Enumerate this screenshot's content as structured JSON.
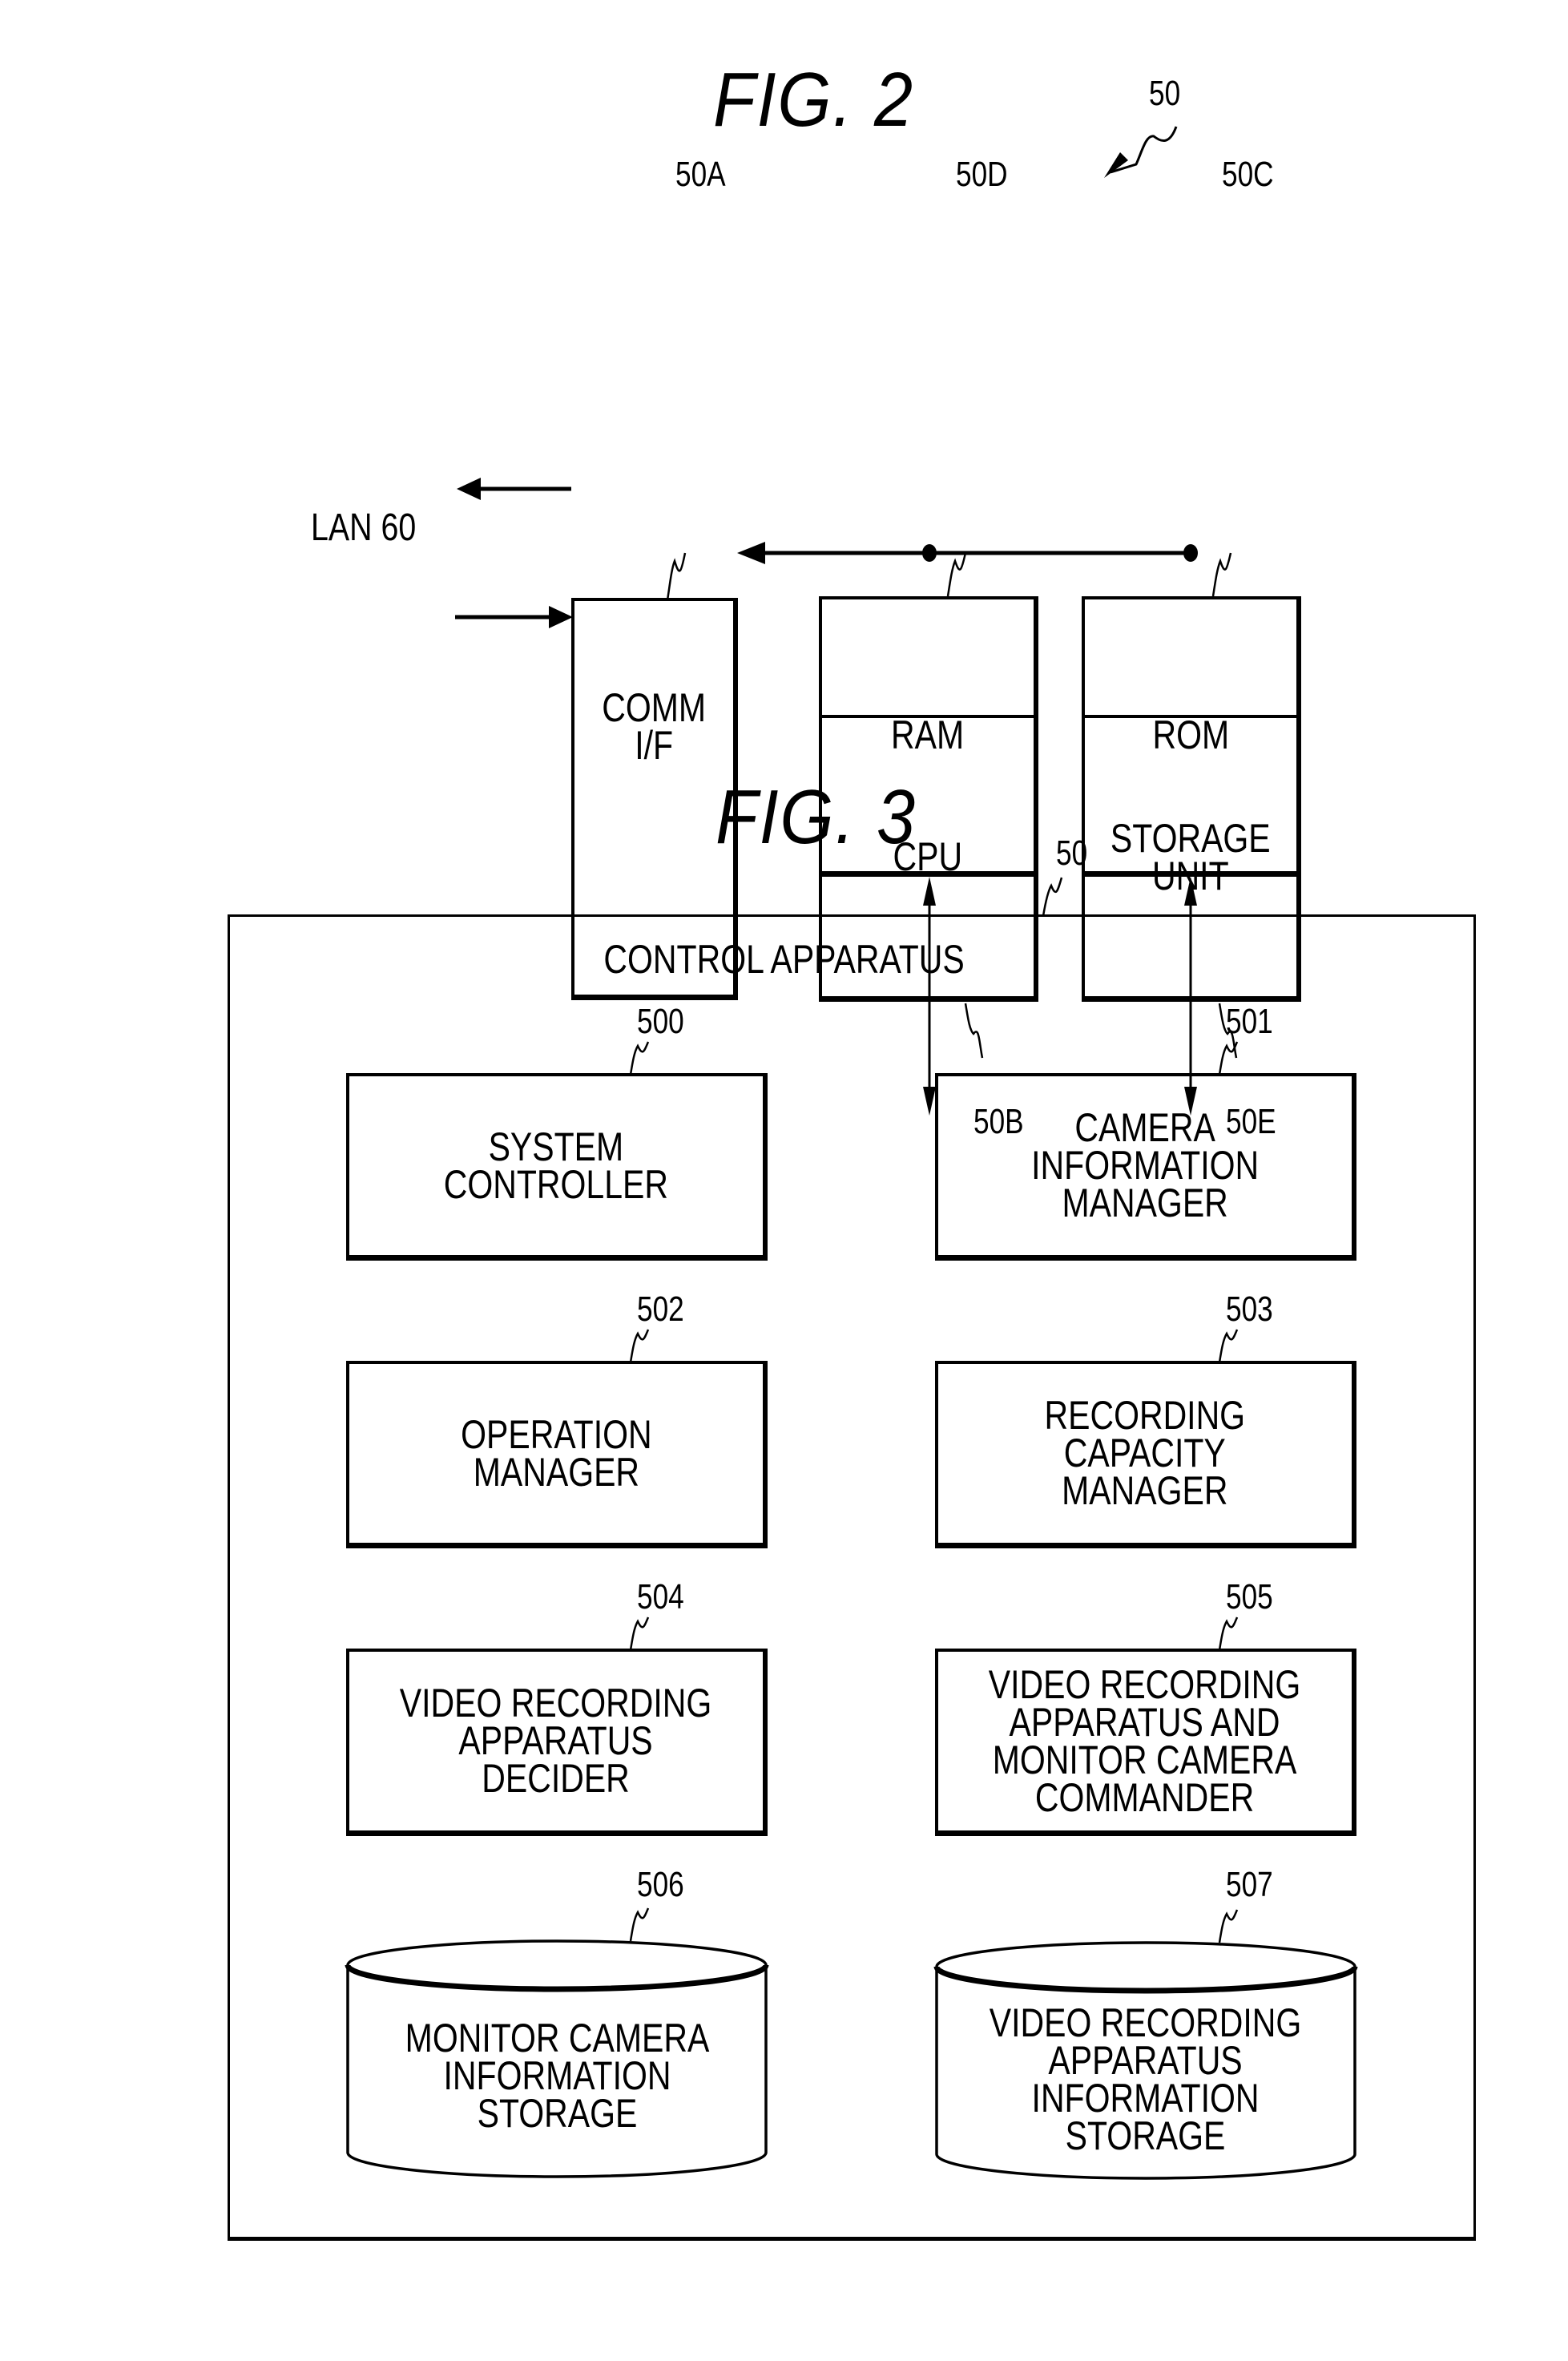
{
  "fig2": {
    "title": "FIG. 2",
    "ref_main": "50",
    "lan_label": "LAN 60",
    "blocks": [
      {
        "id": "50A",
        "label": "COMM\nI/F"
      },
      {
        "id": "50D",
        "label": "RAM"
      },
      {
        "id": "50C",
        "label": "ROM"
      },
      {
        "id": "50B",
        "label": "CPU"
      },
      {
        "id": "50E",
        "label": "STORAGE\nUNIT"
      }
    ]
  },
  "fig3": {
    "title": "FIG. 3",
    "ref_main": "50",
    "container_label": "CONTROL APPARATUS",
    "blocks": [
      {
        "id": "500",
        "label": "SYSTEM\nCONTROLLER",
        "shape": "rect"
      },
      {
        "id": "501",
        "label": "CAMERA\nINFORMATION\nMANAGER",
        "shape": "rect"
      },
      {
        "id": "502",
        "label": "OPERATION\nMANAGER",
        "shape": "rect"
      },
      {
        "id": "503",
        "label": "RECORDING\nCAPACITY\nMANAGER",
        "shape": "rect"
      },
      {
        "id": "504",
        "label": "VIDEO RECORDING\nAPPARATUS\nDECIDER",
        "shape": "rect"
      },
      {
        "id": "505",
        "label": "VIDEO RECORDING\nAPPARATUS AND\nMONITOR CAMERA\nCOMMANDER",
        "shape": "rect"
      },
      {
        "id": "506",
        "label": "MONITOR CAMERA\nINFORMATION\nSTORAGE",
        "shape": "cylinder"
      },
      {
        "id": "507",
        "label": "VIDEO RECORDING\nAPPARATUS\nINFORMATION\nSTORAGE",
        "shape": "cylinder"
      }
    ]
  }
}
